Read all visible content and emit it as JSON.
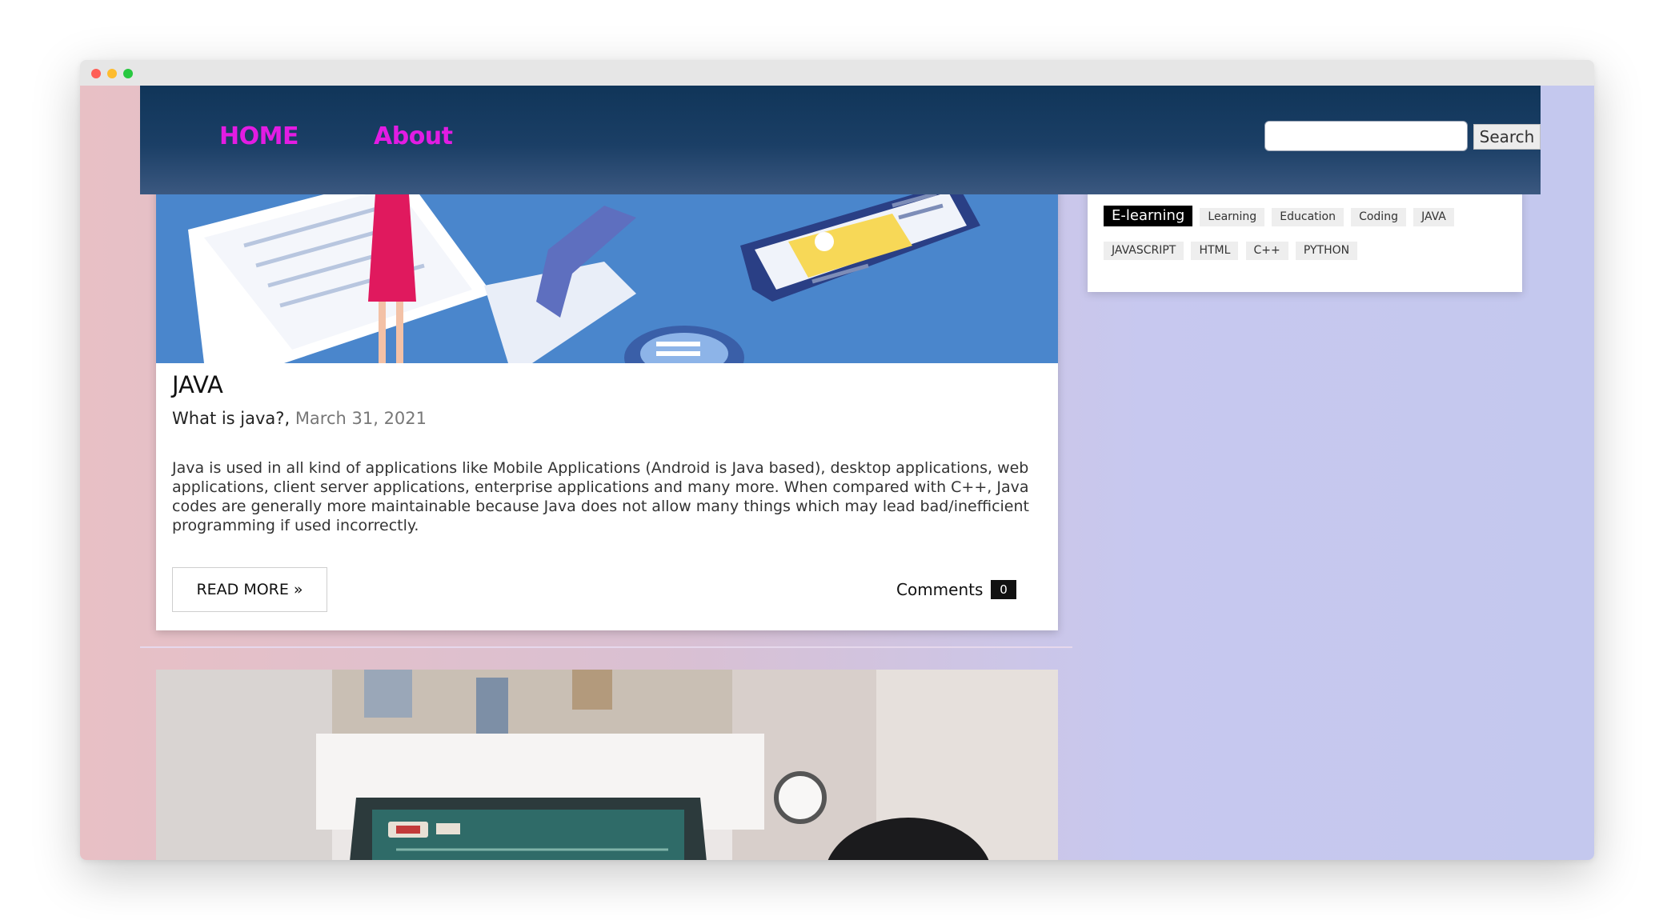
{
  "nav": {
    "home_label": "HOME",
    "about_label": "About",
    "search_button_label": "Search",
    "search_placeholder": ""
  },
  "post": {
    "title": "JAVA",
    "subtitle": "What is java?,",
    "date": "March 31, 2021",
    "excerpt": "Java is used in all kind of applications like Mobile Applications (Android is Java based), desktop applications, web applications, client server applications, enterprise applications and many more. When compared with C++, Java codes are generally more maintainable because Java does not allow many things which may lead bad/inefficient programming if used incorrectly.",
    "read_more_label": "READ MORE »",
    "comments_label": "Comments",
    "comments_count": "0"
  },
  "sidebar": {
    "tags": [
      "E-learning",
      "Learning",
      "Education",
      "Coding",
      "JAVA",
      "JAVASCRIPT",
      "HTML",
      "C++",
      "PYTHON"
    ]
  },
  "colors": {
    "nav_link": "#e21ce3",
    "navbar_top": "#103559",
    "navbar_bottom": "#3b5880",
    "background_left": "#e8c0c5",
    "background_right": "#c4c8ee"
  }
}
